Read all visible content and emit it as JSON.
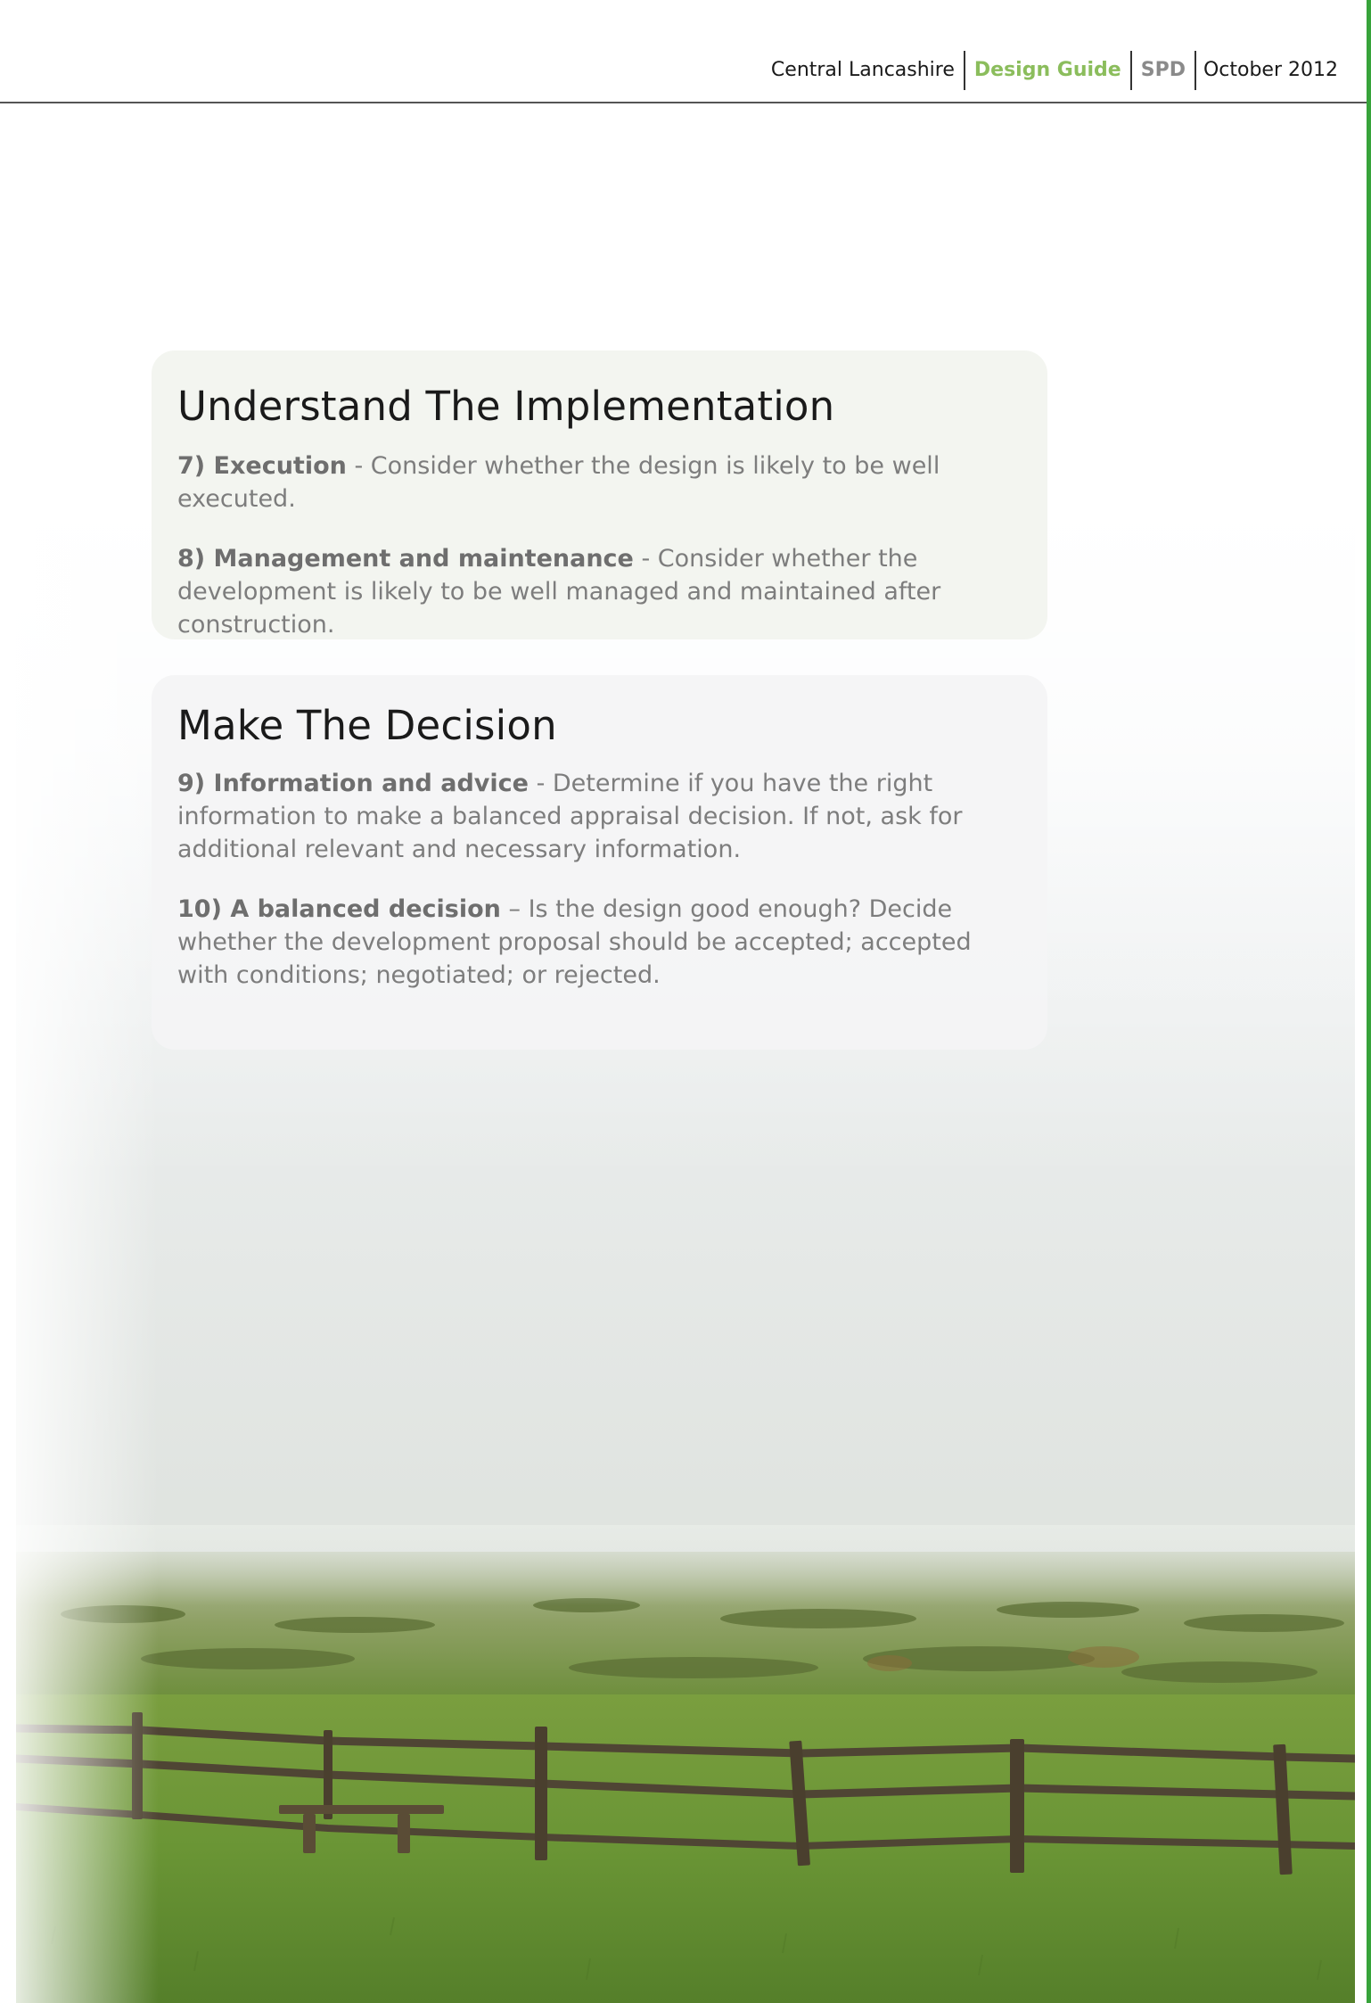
{
  "header": {
    "org": "Central Lancashire",
    "guide": "Design Guide",
    "spd": "SPD",
    "date": "October 2012"
  },
  "colors": {
    "accent_green": "#37a33a",
    "guide_green": "#8bbd5c",
    "panel_1_bg": "#f3f5f0",
    "panel_2_bg": "#f4f4f5"
  },
  "sections": [
    {
      "heading": "Understand The Implementation",
      "items": [
        {
          "label": "7) Execution",
          "text": " - Consider whether the design is likely to be well executed."
        },
        {
          "label": "8) Management and maintenance",
          "text": " - Consider whether the development is likely to be well managed and maintained after construction."
        }
      ]
    },
    {
      "heading": "Make The Decision",
      "items": [
        {
          "label": "9) Information and advice",
          "text": " - Determine if you have the right information to make a balanced appraisal decision. If not, ask for additional relevant and necessary information."
        },
        {
          "label": "10) A balanced decision",
          "text": " – Is the design good enough? Decide whether the development proposal should be accepted; accepted with conditions; negotiated; or rejected."
        }
      ]
    }
  ],
  "background_image": "countryside-landscape-with-wooden-fence"
}
